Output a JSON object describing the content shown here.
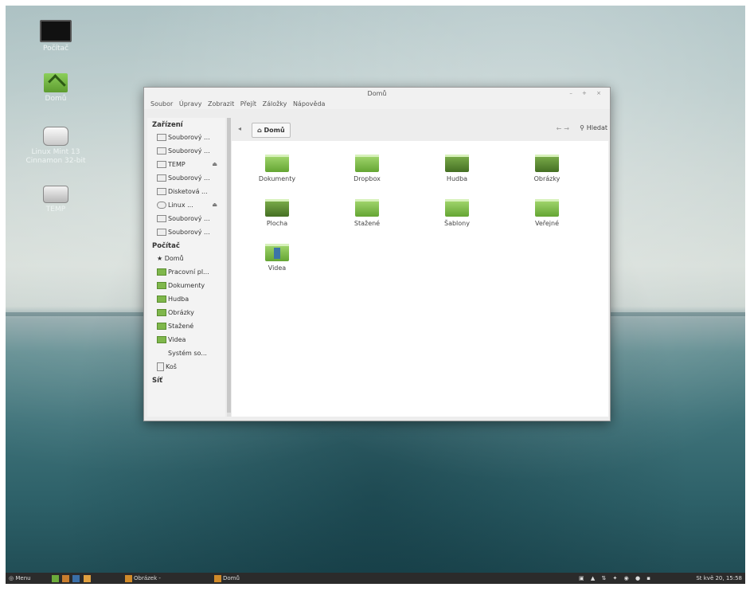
{
  "desktop": {
    "icons": [
      {
        "label": "Počítač",
        "icon": "monitor-icon"
      },
      {
        "label": "Domů",
        "icon": "home-folder-icon"
      },
      {
        "label": "Linux Mint 13 Cinnamon 32-bit",
        "icon": "disc-icon"
      },
      {
        "label": "TEMP",
        "icon": "drive-icon"
      }
    ]
  },
  "window": {
    "title": "Domů",
    "controls": "– + ×",
    "menu": [
      "Soubor",
      "Úpravy",
      "Zobrazit",
      "Přejít",
      "Záložky",
      "Nápověda"
    ],
    "sidebar": {
      "devices_header": "Zařízení",
      "devices": [
        {
          "label": "Souborový ...",
          "eject": false
        },
        {
          "label": "Souborový ...",
          "eject": false
        },
        {
          "label": "TEMP",
          "eject": true
        },
        {
          "label": "Souborový ...",
          "eject": false
        },
        {
          "label": "Disketová ...",
          "eject": false
        },
        {
          "label": "Linux ...",
          "eject": true
        },
        {
          "label": "Souborový ...",
          "eject": false
        },
        {
          "label": "Souborový ...",
          "eject": false
        }
      ],
      "computer_header": "Počítač",
      "computer": [
        {
          "label": "Domů",
          "icon": "star-icon"
        },
        {
          "label": "Pracovní pl...",
          "icon": "desktop-folder-icon"
        },
        {
          "label": "Dokumenty",
          "icon": "documents-folder-icon"
        },
        {
          "label": "Hudba",
          "icon": "music-folder-icon"
        },
        {
          "label": "Obrázky",
          "icon": "pictures-folder-icon"
        },
        {
          "label": "Stažené",
          "icon": "downloads-folder-icon"
        },
        {
          "label": "Videa",
          "icon": "videos-folder-icon"
        },
        {
          "label": "Systém so...",
          "icon": "filesystem-icon"
        },
        {
          "label": "Koš",
          "icon": "trash-icon"
        }
      ],
      "network_header": "Síť"
    },
    "toolbar": {
      "breadcrumb": "Domů",
      "search_label": "Hledat"
    },
    "files": [
      {
        "label": "Dokumenty",
        "style": "light"
      },
      {
        "label": "Dropbox",
        "style": "light"
      },
      {
        "label": "Hudba",
        "style": "dark"
      },
      {
        "label": "Obrázky",
        "style": "dark"
      },
      {
        "label": "Plocha",
        "style": "dark"
      },
      {
        "label": "Stažené",
        "style": "light"
      },
      {
        "label": "Šablony",
        "style": "light"
      },
      {
        "label": "Veřejné",
        "style": "light"
      },
      {
        "label": "Videa",
        "style": "blue"
      }
    ]
  },
  "taskbar": {
    "menu_label": "Menu",
    "tasks": [
      "Obrázek - ",
      "Domů"
    ],
    "clock": "St kvě 20, 15:58"
  }
}
